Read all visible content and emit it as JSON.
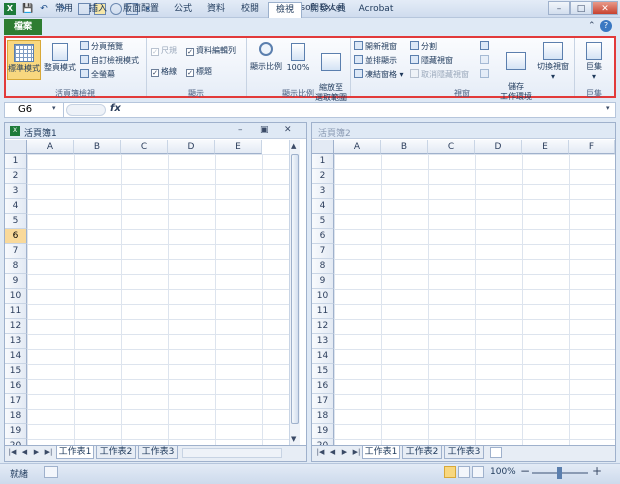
{
  "window": {
    "title": "Microsoft Excel"
  },
  "qat": {
    "save": "💾",
    "undo": "↶",
    "redo": "↷"
  },
  "tabs": {
    "file": "檔案",
    "items": [
      "常用",
      "插入",
      "版面配置",
      "公式",
      "資料",
      "校閱",
      "檢視",
      "開發人員",
      "Acrobat"
    ],
    "active_index": 6
  },
  "ribbon": {
    "groups": {
      "workbook_views": "活頁簿檢視",
      "show": "顯示",
      "zoom": "顯示比例",
      "window": "視窗",
      "macros": "巨集"
    },
    "workbook_views": {
      "normal": "標準模式",
      "page_layout": "整頁模式",
      "page_break": "分頁預覽",
      "custom_views": "自訂檢視模式",
      "full_screen": "全螢幕"
    },
    "show": {
      "ruler": "尺規",
      "formula_bar": "資料編輯列",
      "gridlines": "格線",
      "headings": "標題"
    },
    "zoom": {
      "zoom": "顯示比例",
      "hundred": "100%",
      "zoom_to_selection": "縮放至\n選取範圍"
    },
    "window": {
      "new_window": "開新視窗",
      "arrange_all": "並排顯示",
      "freeze_panes": "凍結窗格",
      "split": "分割",
      "hide": "隱藏視窗",
      "unhide": "取消隱藏視窗",
      "save_workspace": "儲存\n工作環境",
      "switch_windows": "切換視窗"
    },
    "macros": {
      "macros": "巨集"
    }
  },
  "formula": {
    "name_box": "G6",
    "fx": "fx",
    "value": ""
  },
  "pane1": {
    "title": "活頁簿1",
    "columns": [
      "A",
      "B",
      "C",
      "D",
      "E"
    ],
    "rows": [
      "1",
      "2",
      "3",
      "4",
      "5",
      "6",
      "7",
      "8",
      "9",
      "10",
      "11",
      "12",
      "13",
      "14",
      "15",
      "16",
      "17",
      "18",
      "19",
      "20"
    ],
    "selected_row": "6",
    "sheets": [
      "工作表1",
      "工作表2",
      "工作表3"
    ]
  },
  "pane2": {
    "title": "活頁簿2",
    "columns": [
      "A",
      "B",
      "C",
      "D",
      "E",
      "F"
    ],
    "rows": [
      "1",
      "2",
      "3",
      "4",
      "5",
      "6",
      "7",
      "8",
      "9",
      "10",
      "11",
      "12",
      "13",
      "14",
      "15",
      "16",
      "17",
      "18",
      "19",
      "20"
    ],
    "sheets": [
      "工作表1",
      "工作表2",
      "工作表3"
    ]
  },
  "status": {
    "ready": "就緒",
    "zoom": "100%",
    "minus": "−",
    "plus": "+"
  }
}
